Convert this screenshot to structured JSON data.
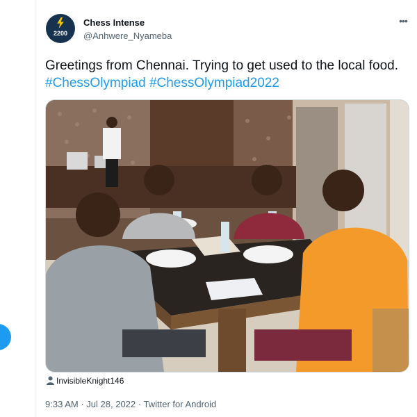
{
  "author": {
    "display_name": "Chess Intense",
    "handle": "@Anhwere_Nyameba",
    "avatar_rating": "2200",
    "more_icon": "more-horizontal-icon"
  },
  "tweet": {
    "text_plain": "Greetings from Chennai. Trying to get used to the local food. ",
    "hashtags": [
      "#ChessOlympiad",
      "#ChessOlympiad2022"
    ]
  },
  "media": {
    "photo_icon": "photo-of-chess-players-at-dinner-table",
    "tagged_user": "InvisibleKnight146",
    "tag_icon": "person-icon"
  },
  "meta": {
    "time": "9:33 AM",
    "date": "Jul 28, 2022",
    "source": "Twitter for Android",
    "separator": "·"
  },
  "colors": {
    "accent": "#1d9bf0",
    "text_primary": "#0f1419",
    "text_secondary": "#536471"
  }
}
